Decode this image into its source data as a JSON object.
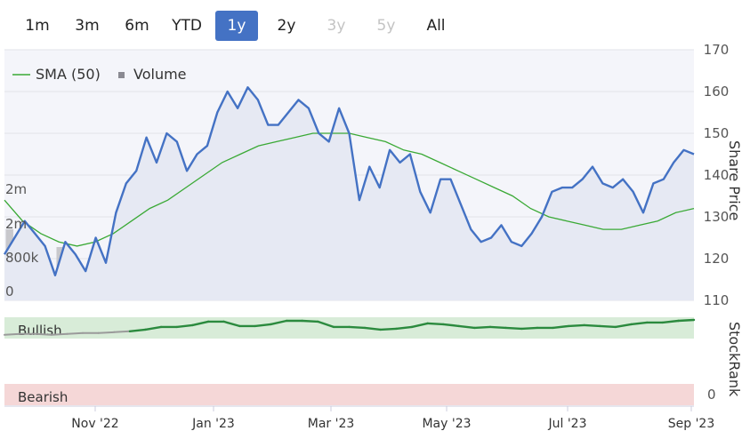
{
  "range_buttons": [
    {
      "label": "1m",
      "state": "normal"
    },
    {
      "label": "3m",
      "state": "normal"
    },
    {
      "label": "6m",
      "state": "normal"
    },
    {
      "label": "YTD",
      "state": "normal"
    },
    {
      "label": "1y",
      "state": "active"
    },
    {
      "label": "2y",
      "state": "normal"
    },
    {
      "label": "3y",
      "state": "disabled"
    },
    {
      "label": "5y",
      "state": "disabled"
    },
    {
      "label": "All",
      "state": "normal"
    }
  ],
  "legend": {
    "sma_label": "SMA (50)",
    "volume_label": "Volume"
  },
  "colors": {
    "price": "#4472c4",
    "sma": "#3aa935",
    "volume": "#c8c8cc",
    "stockrank_good": "#2b8a3e",
    "stockrank_neutral": "#9a9a9a",
    "bullish_bg": "#d8ecd8",
    "bearish_bg": "#f5d7d7",
    "active_button": "#4472c4"
  },
  "chart_data": [
    {
      "type": "line",
      "name": "price",
      "right_axis_title": "Share Price",
      "ylim": [
        110,
        170
      ],
      "yticks": [
        110,
        120,
        130,
        140,
        150,
        160,
        170
      ],
      "volume_ticks": [
        "0",
        "800k",
        "2m",
        "2m"
      ],
      "x_tick_labels": [
        "Nov '22",
        "Jan '23",
        "Mar '23",
        "May '23",
        "Jul '23",
        "Sep '23"
      ],
      "grid": true,
      "legend_position": "top-left",
      "series": [
        {
          "name": "",
          "values": [
            121,
            125,
            129,
            126,
            123,
            116,
            124,
            121,
            117,
            125,
            119,
            131,
            138,
            141,
            149,
            143,
            150,
            148,
            141,
            145,
            147,
            155,
            160,
            156,
            161,
            158,
            152,
            152,
            155,
            158,
            156,
            150,
            148,
            156,
            150,
            134,
            142,
            137,
            146,
            143,
            145,
            136,
            131,
            139,
            139,
            133,
            127,
            124,
            125,
            128,
            124,
            123,
            126,
            130,
            136,
            137,
            137,
            139,
            142,
            138,
            137,
            139,
            136,
            131,
            138,
            139,
            143,
            146,
            145
          ]
        },
        {
          "name": "SMA (50)",
          "values": [
            134,
            129,
            126,
            124,
            123,
            124,
            126,
            129,
            132,
            134,
            137,
            140,
            143,
            145,
            147,
            148,
            149,
            150,
            150,
            150,
            149,
            148,
            146,
            145,
            143,
            141,
            139,
            137,
            135,
            132,
            130,
            129,
            128,
            127,
            127,
            128,
            129,
            131,
            132
          ]
        }
      ],
      "volume_values": [
        1.9,
        0.9,
        1.1,
        0.6,
        0.5,
        1.4,
        0.8,
        0.4,
        0.6,
        0.7,
        0.8,
        0.4,
        1.2,
        0.7,
        0.9,
        0.5,
        0.6,
        0.4,
        0.7,
        0.9,
        1.1,
        0.3,
        0.6,
        0.8,
        0.5,
        0.7,
        0.6,
        0.9,
        0.4,
        0.6,
        1.8,
        0.8,
        0.5,
        1.7,
        0.6,
        0.4,
        0.5,
        0.7,
        0.9,
        0.6,
        0.5,
        1.1,
        0.4,
        0.6,
        0.8,
        0.7,
        0.5,
        0.9,
        0.6,
        0.4,
        0.7,
        1.3,
        0.5,
        0.6,
        0.8,
        0.5,
        0.9,
        0.6,
        0.7,
        0.4,
        0.6,
        1.4,
        0.8,
        0.5,
        0.6,
        1.7,
        0.9,
        1.9
      ]
    },
    {
      "type": "line",
      "name": "stockrank",
      "right_axis_title": "StockRank",
      "bullish_label": "Bullish",
      "bearish_label": "Bearish",
      "zero_label": "0",
      "ylim": [
        0,
        100
      ],
      "values": [
        80,
        81,
        81,
        80,
        81,
        82,
        82,
        83,
        84,
        86,
        89,
        89,
        91,
        95,
        95,
        90,
        90,
        92,
        96,
        96,
        95,
        89,
        89,
        88,
        86,
        87,
        89,
        93,
        92,
        90,
        88,
        89,
        88,
        87,
        88,
        88,
        90,
        91,
        90,
        89,
        92,
        94,
        94,
        96,
        97
      ]
    }
  ]
}
